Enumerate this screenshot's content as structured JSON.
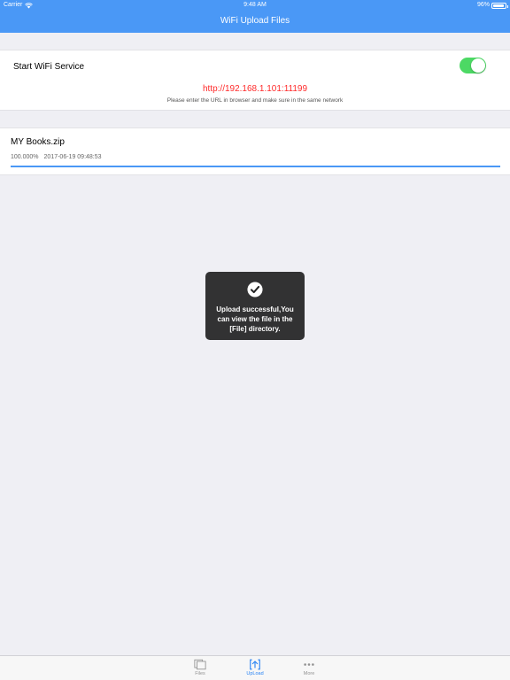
{
  "status_bar": {
    "carrier": "Carrier",
    "time": "9:48 AM",
    "battery_text": "96%",
    "battery_level": 0.96
  },
  "nav": {
    "title": "WiFi Upload Files"
  },
  "wifi_service": {
    "label": "Start WiFi Service",
    "enabled": true,
    "url": "http://192.168.1.101:11199",
    "hint": "Please enter the URL in browser and make sure in the same network"
  },
  "upload": {
    "file_name": "MY Books.zip",
    "progress_text": "100.000%",
    "progress": 1.0,
    "timestamp": "2017-06-19 09:48:53"
  },
  "toast": {
    "icon": "checkmark-circle-icon",
    "message": "Upload successful,You can view the file in the [File] directory."
  },
  "tabs": [
    {
      "label": "Files",
      "icon": "files-icon",
      "active": false
    },
    {
      "label": "UpLoad",
      "icon": "upload-icon",
      "active": true
    },
    {
      "label": "More",
      "icon": "more-icon",
      "active": false
    }
  ],
  "colors": {
    "accent": "#4a98f6",
    "toggle_on": "#4cd964",
    "url": "#ff2a2a",
    "background": "#efeff4"
  }
}
